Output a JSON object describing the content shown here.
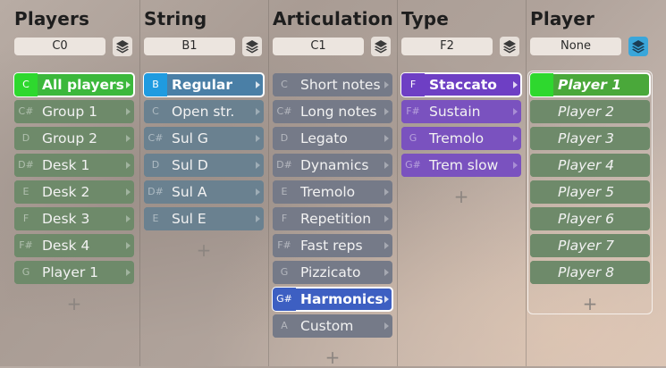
{
  "columns": [
    {
      "title": "Players",
      "key": "C0",
      "layer_active": false,
      "items": [
        {
          "key": "C",
          "label": "All players",
          "selected": true,
          "bg": "#3cb83c",
          "keybg": "#2ed82e"
        },
        {
          "key": "C#",
          "label": "Group 1",
          "bg": "#6e8a6a",
          "keybg": "#6e8a6a"
        },
        {
          "key": "D",
          "label": "Group 2",
          "bg": "#6e8a6a",
          "keybg": "#6e8a6a"
        },
        {
          "key": "D#",
          "label": "Desk 1",
          "bg": "#6e8a6a",
          "keybg": "#6e8a6a"
        },
        {
          "key": "E",
          "label": "Desk 2",
          "bg": "#6e8a6a",
          "keybg": "#6e8a6a"
        },
        {
          "key": "F",
          "label": "Desk 3",
          "bg": "#6e8a6a",
          "keybg": "#6e8a6a"
        },
        {
          "key": "F#",
          "label": "Desk 4",
          "bg": "#6e8a6a",
          "keybg": "#6e8a6a"
        },
        {
          "key": "G",
          "label": "Player 1",
          "bg": "#6e8a6a",
          "keybg": "#6e8a6a"
        }
      ],
      "plus": "+"
    },
    {
      "title": "String",
      "key": "B1",
      "layer_active": false,
      "items": [
        {
          "key": "B",
          "label": "Regular",
          "selected": true,
          "bg": "#4a7fa6",
          "keybg": "#1f9be0"
        },
        {
          "key": "C",
          "label": "Open str.",
          "bg": "#6a8190",
          "keybg": "#6a8190"
        },
        {
          "key": "C#",
          "label": "Sul G",
          "bg": "#6a8190",
          "keybg": "#6a8190"
        },
        {
          "key": "D",
          "label": "Sul D",
          "bg": "#6a8190",
          "keybg": "#6a8190"
        },
        {
          "key": "D#",
          "label": "Sul A",
          "bg": "#6a8190",
          "keybg": "#6a8190"
        },
        {
          "key": "E",
          "label": "Sul E",
          "bg": "#6a8190",
          "keybg": "#6a8190"
        }
      ],
      "plus": "+"
    },
    {
      "title": "Articulation",
      "key": "C1",
      "layer_active": false,
      "items": [
        {
          "key": "C",
          "label": "Short notes",
          "bg": "#757a88",
          "keybg": "#757a88"
        },
        {
          "key": "C#",
          "label": "Long notes",
          "bg": "#757a88",
          "keybg": "#757a88"
        },
        {
          "key": "D",
          "label": "Legato",
          "bg": "#757a88",
          "keybg": "#757a88"
        },
        {
          "key": "D#",
          "label": "Dynamics",
          "bg": "#757a88",
          "keybg": "#757a88"
        },
        {
          "key": "E",
          "label": "Tremolo",
          "bg": "#757a88",
          "keybg": "#757a88"
        },
        {
          "key": "F",
          "label": "Repetition",
          "bg": "#757a88",
          "keybg": "#757a88"
        },
        {
          "key": "F#",
          "label": "Fast reps",
          "bg": "#757a88",
          "keybg": "#757a88"
        },
        {
          "key": "G",
          "label": "Pizzicato",
          "bg": "#757a88",
          "keybg": "#757a88"
        },
        {
          "key": "G#",
          "label": "Harmonics",
          "selected": true,
          "bg": "#3d5fc2",
          "keybg": "#3d5fc2"
        },
        {
          "key": "A",
          "label": "Custom",
          "bg": "#757a88",
          "keybg": "#757a88"
        }
      ],
      "plus": "+"
    },
    {
      "title": "Type",
      "key": "F2",
      "layer_active": false,
      "items": [
        {
          "key": "F",
          "label": "Staccato",
          "selected": true,
          "bg": "#6e3fc4",
          "keybg": "#6e3fc4"
        },
        {
          "key": "F#",
          "label": "Sustain",
          "bg": "#7a52bf",
          "keybg": "#7a52bf"
        },
        {
          "key": "G",
          "label": "Tremolo",
          "bg": "#7a52bf",
          "keybg": "#7a52bf"
        },
        {
          "key": "G#",
          "label": "Trem slow",
          "bg": "#7a52bf",
          "keybg": "#7a52bf"
        }
      ],
      "plus": "+"
    },
    {
      "title": "Player",
      "key": "None",
      "layer_active": true,
      "italic": true,
      "items": [
        {
          "key": "",
          "label": "Player 1",
          "selected": true,
          "bg": "#4aa83a",
          "keybg": "#2ed82e"
        },
        {
          "key": "",
          "label": "Player 2",
          "bg": "#6e8a6a",
          "keybg": "#6e8a6a"
        },
        {
          "key": "",
          "label": "Player 3",
          "bg": "#6e8a6a",
          "keybg": "#6e8a6a"
        },
        {
          "key": "",
          "label": "Player 4",
          "bg": "#6e8a6a",
          "keybg": "#6e8a6a"
        },
        {
          "key": "",
          "label": "Player 5",
          "bg": "#6e8a6a",
          "keybg": "#6e8a6a"
        },
        {
          "key": "",
          "label": "Player 6",
          "bg": "#6e8a6a",
          "keybg": "#6e8a6a"
        },
        {
          "key": "",
          "label": "Player 7",
          "bg": "#6e8a6a",
          "keybg": "#6e8a6a"
        },
        {
          "key": "",
          "label": "Player 8",
          "bg": "#6e8a6a",
          "keybg": "#6e8a6a"
        }
      ],
      "plus": "+"
    }
  ],
  "icons": {
    "layer": "layers-icon",
    "arrow": "chevron-right-icon",
    "add": "plus-icon"
  }
}
